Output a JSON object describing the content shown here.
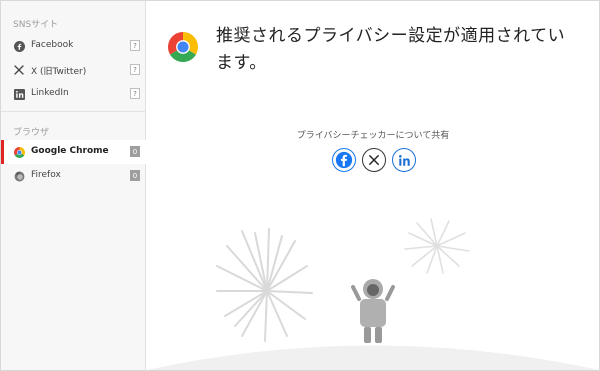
{
  "sidebar": {
    "sns_title": "SNSサイト",
    "browser_title": "ブラウザ",
    "sns_items": [
      {
        "label": "Facebook",
        "badge": "?",
        "icon": "facebook-icon"
      },
      {
        "label": "X (旧Twitter)",
        "badge": "?",
        "icon": "x-icon"
      },
      {
        "label": "LinkedIn",
        "badge": "?",
        "icon": "linkedin-icon"
      }
    ],
    "browser_items": [
      {
        "label": "Google Chrome",
        "badge": "0",
        "icon": "chrome-icon",
        "active": true
      },
      {
        "label": "Firefox",
        "badge": "0",
        "icon": "firefox-icon",
        "active": false
      }
    ]
  },
  "main": {
    "headline": "推奨されるプライバシー設定が適用されています。",
    "share_label": "プライバシーチェッカーについて共有",
    "share_buttons": [
      "facebook-share-icon",
      "x-share-icon",
      "linkedin-share-icon"
    ]
  },
  "colors": {
    "accent": "#e02424",
    "facebook": "#1877f2",
    "linkedin": "#1b6fd6"
  }
}
